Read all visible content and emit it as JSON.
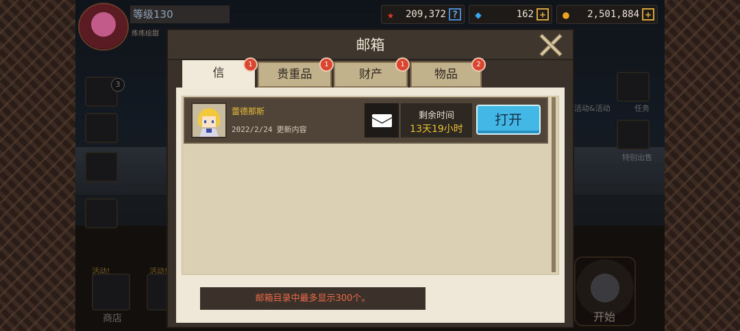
{
  "hud": {
    "level_label": "等级130",
    "subtitle": "练练绘甜",
    "stars": "209,372",
    "stars_icon": "red-star-icon",
    "gems": "162",
    "gems_icon": "blue-diamond-icon",
    "gold": "2,501,884",
    "gold_icon": "gold-coin-icon"
  },
  "mailbox": {
    "title": "邮箱",
    "tabs": [
      {
        "label": "信",
        "badge": "1",
        "active": true
      },
      {
        "label": "贵重品",
        "badge": "1"
      },
      {
        "label": "财产",
        "badge": "1"
      },
      {
        "label": "物品",
        "badge": "2"
      }
    ],
    "mails": [
      {
        "sender": "蕾德那斯",
        "date": "2022/2/24",
        "subject": "更新内容",
        "remaining_label": "剩余时间",
        "remaining_value": "13天19小时",
        "open_label": "打开"
      }
    ],
    "footer_note": "邮箱目录中最多显示300个。"
  },
  "background": {
    "side_badges": [
      "3"
    ],
    "labels": {
      "activity_right": "活动&活动",
      "duty": "任务",
      "special_sale": "特别出售",
      "shop": "商店",
      "start": "开始",
      "event_badge_1": "活动!",
      "event_badge_2": "活动!"
    }
  },
  "colors": {
    "open_button": "#43b8e6",
    "badge_red": "#d9452e",
    "time_value": "#eec236",
    "note_text": "#ec6a48",
    "sender_name": "#e8be3a"
  }
}
